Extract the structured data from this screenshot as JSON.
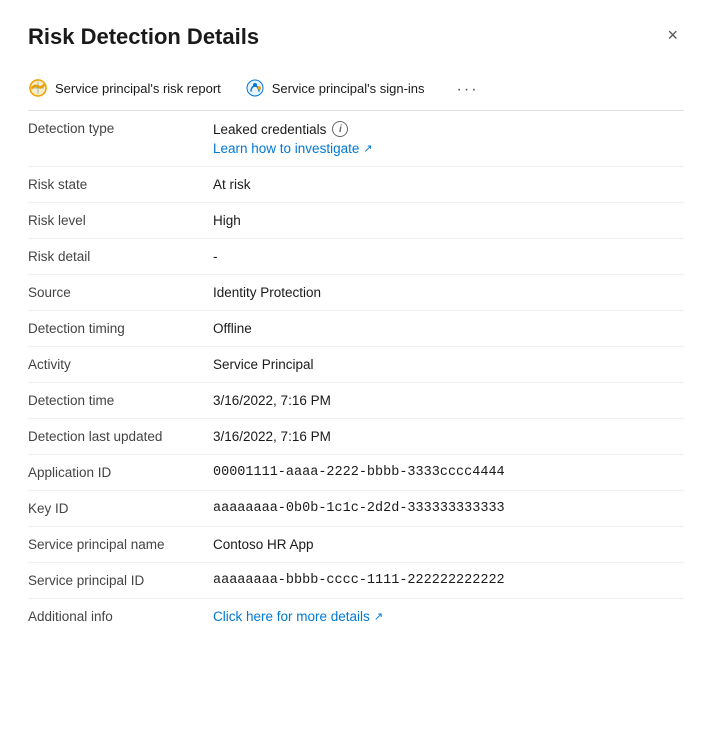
{
  "panel": {
    "title": "Risk Detection Details",
    "close_label": "×"
  },
  "nav": {
    "tabs": [
      {
        "id": "risk-report",
        "label": "Service principal's risk report",
        "icon": "risk-report-icon"
      },
      {
        "id": "sign-ins",
        "label": "Service principal's sign-ins",
        "icon": "sign-ins-icon"
      }
    ],
    "more_label": "···"
  },
  "fields": [
    {
      "label": "Detection type",
      "value": "Leaked credentials",
      "has_info": true,
      "has_link": true,
      "link_text": "Learn how to investigate",
      "link_href": "#"
    },
    {
      "label": "Risk state",
      "value": "At risk",
      "has_info": false,
      "has_link": false
    },
    {
      "label": "Risk level",
      "value": "High",
      "has_info": false,
      "has_link": false
    },
    {
      "label": "Risk detail",
      "value": "-",
      "has_info": false,
      "has_link": false
    },
    {
      "label": "Source",
      "value": "Identity Protection",
      "has_info": false,
      "has_link": false
    },
    {
      "label": "Detection timing",
      "value": "Offline",
      "has_info": false,
      "has_link": false
    },
    {
      "label": "Activity",
      "value": "Service Principal",
      "has_info": false,
      "has_link": false
    },
    {
      "label": "Detection time",
      "value": "3/16/2022, 7:16 PM",
      "has_info": false,
      "has_link": false
    },
    {
      "label": "Detection last updated",
      "value": "3/16/2022, 7:16 PM",
      "has_info": false,
      "has_link": false
    },
    {
      "label": "Application ID",
      "value": "00001111-aaaa-2222-bbbb-3333cccc4444",
      "has_info": false,
      "has_link": false,
      "monospace": true
    },
    {
      "label": "Key ID",
      "value": "aaaaaaaa-0b0b-1c1c-2d2d-333333333333",
      "has_info": false,
      "has_link": false,
      "monospace": true
    },
    {
      "label": "Service principal name",
      "value": "Contoso HR App",
      "has_info": false,
      "has_link": false
    },
    {
      "label": "Service principal ID",
      "value": "aaaaaaaa-bbbb-cccc-1111-222222222222",
      "has_info": false,
      "has_link": false,
      "monospace": true
    },
    {
      "label": "Additional info",
      "value": "",
      "has_info": false,
      "has_link": true,
      "link_text": "Click here for more details",
      "link_href": "#"
    }
  ]
}
